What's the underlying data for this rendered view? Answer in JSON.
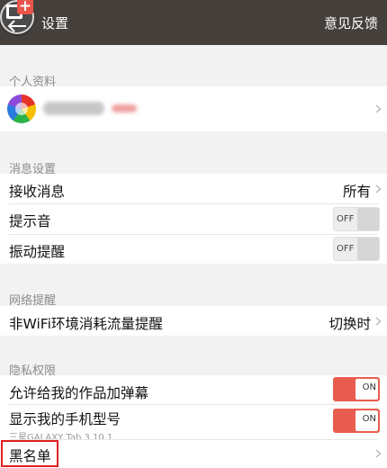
{
  "header": {
    "title": "设置",
    "feedback_label": "意见反馈",
    "app_icon": "app-add-icon",
    "back_icon": "back-arrow-icon"
  },
  "profile": {
    "section_label": "个人资料",
    "name_obscured": true
  },
  "messages": {
    "section_label": "消息设置",
    "receive": {
      "label": "接收消息",
      "value": "所有"
    },
    "sound": {
      "label": "提示音",
      "state": "OFF"
    },
    "vibrate": {
      "label": "振动提醒",
      "state": "OFF"
    }
  },
  "network": {
    "section_label": "网络提醒",
    "non_wifi": {
      "label": "非WiFi环境消耗流量提醒",
      "value": "切换时"
    }
  },
  "privacy": {
    "section_label": "隐私权限",
    "danmaku": {
      "label": "允许给我的作品加弹幕",
      "state": "ON"
    },
    "phone_model": {
      "label": "显示我的手机型号",
      "subtitle": "三星GALAXY Tab 3 10.1",
      "state": "ON"
    },
    "blacklist": {
      "label": "黑名单"
    }
  },
  "colors": {
    "header_bg": "#45403c",
    "toggle_on": "#e85c4f",
    "highlight": "#e02020",
    "section_text": "#8c8c8c"
  }
}
